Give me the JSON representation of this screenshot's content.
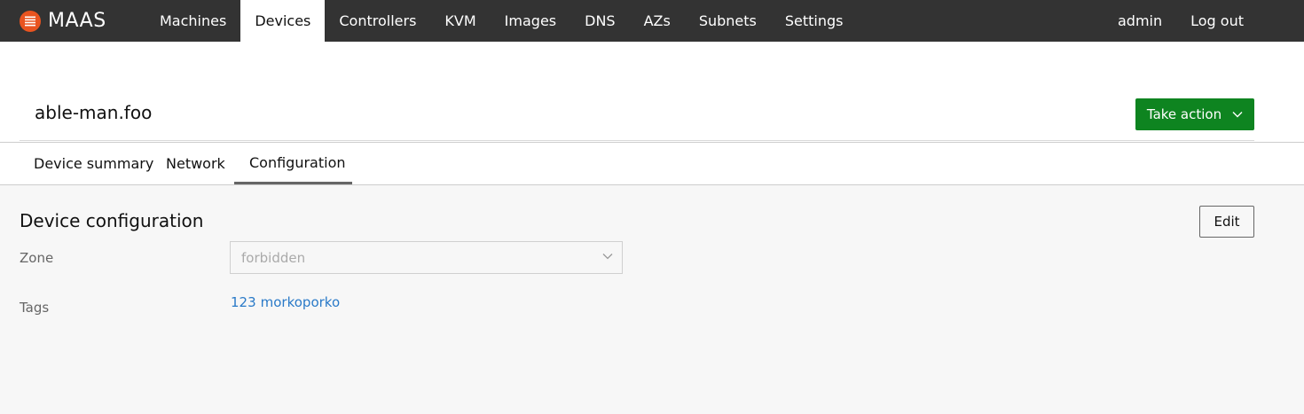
{
  "app": {
    "name": "MAAS",
    "logo_icon": "maas-logo-icon",
    "brand_color": "#e95420"
  },
  "nav": {
    "items": [
      {
        "label": "Machines"
      },
      {
        "label": "Devices",
        "active": true
      },
      {
        "label": "Controllers"
      },
      {
        "label": "KVM"
      },
      {
        "label": "Images"
      },
      {
        "label": "DNS"
      },
      {
        "label": "AZs"
      },
      {
        "label": "Subnets"
      },
      {
        "label": "Settings"
      }
    ],
    "user": "admin",
    "logout": "Log out"
  },
  "header": {
    "title": "able-man.foo",
    "take_action_label": "Take action",
    "take_action_color": "#0e8420"
  },
  "tabs": [
    {
      "label": "Device summary"
    },
    {
      "label": "Network"
    },
    {
      "label": "Configuration",
      "active": true
    }
  ],
  "config": {
    "title": "Device configuration",
    "edit_label": "Edit",
    "zone": {
      "label": "Zone",
      "value": "forbidden"
    },
    "tags": {
      "label": "Tags",
      "values": [
        "123",
        "morkoporko"
      ]
    },
    "link_color": "#2a7ac8"
  }
}
